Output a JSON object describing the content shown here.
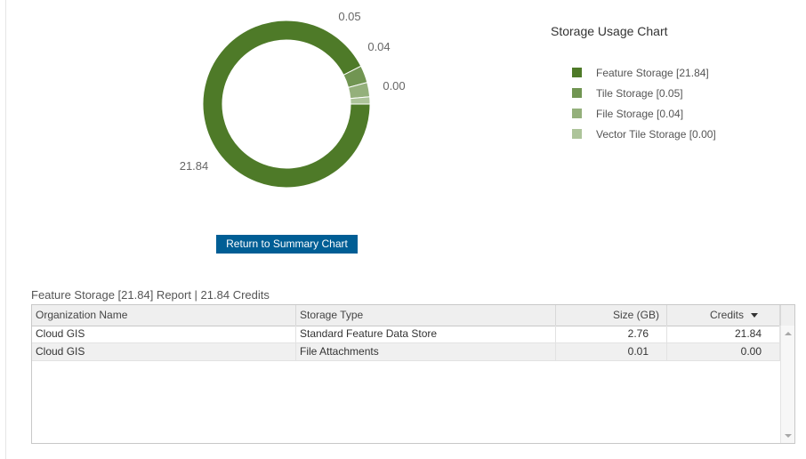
{
  "chart_data": {
    "type": "pie",
    "variant": "donut",
    "title": "Storage Usage Chart",
    "categories": [
      "Feature Storage [21.84]",
      "Tile Storage [0.05]",
      "File Storage [0.04]",
      "Vector Tile Storage [0.00]"
    ],
    "slice_labels": [
      "21.84",
      "0.05",
      "0.04",
      "0.00"
    ],
    "values": [
      21.84,
      0.05,
      0.04,
      0.0
    ],
    "colors": [
      "#4e7a28",
      "#719552",
      "#94b07b",
      "#adc49a"
    ],
    "legend_position": "right"
  },
  "buttons": {
    "return_label": "Return to Summary Chart"
  },
  "report": {
    "title": "Feature Storage [21.84] Report | 21.84 Credits",
    "columns": [
      "Organization Name",
      "Storage Type",
      "Size (GB)",
      "Credits"
    ],
    "rows": [
      [
        "Cloud GIS",
        "Standard Feature Data Store",
        "2.76",
        "21.84"
      ],
      [
        "Cloud GIS",
        "File Attachments",
        "0.01",
        "0.00"
      ]
    ],
    "sort_icon": "sort-descending-icon"
  }
}
